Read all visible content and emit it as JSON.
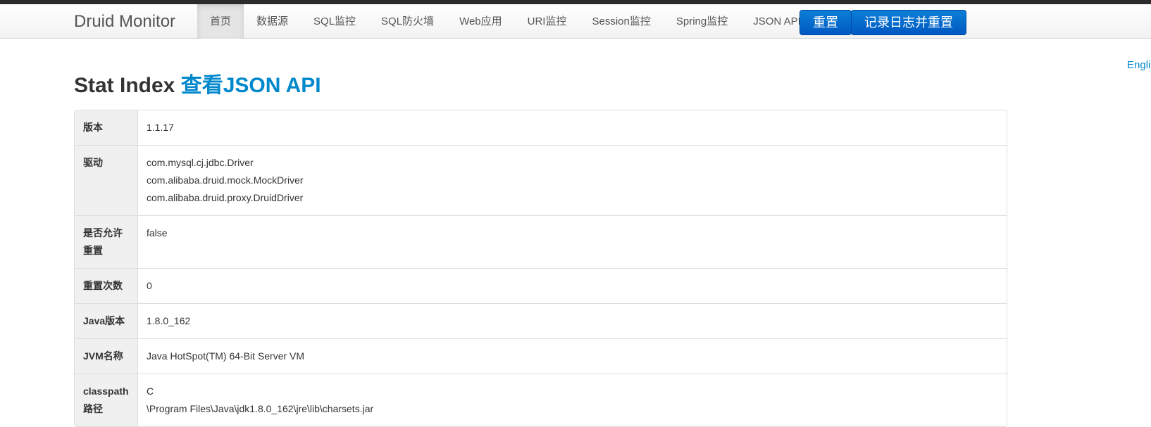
{
  "nav": {
    "brand": "Druid Monitor",
    "items": [
      {
        "label": "首页",
        "active": true
      },
      {
        "label": "数据源",
        "active": false
      },
      {
        "label": "SQL监控",
        "active": false
      },
      {
        "label": "SQL防火墙",
        "active": false
      },
      {
        "label": "Web应用",
        "active": false
      },
      {
        "label": "URI监控",
        "active": false
      },
      {
        "label": "Session监控",
        "active": false
      },
      {
        "label": "Spring监控",
        "active": false
      },
      {
        "label": "JSON API",
        "active": false
      }
    ],
    "reset_button": "重置",
    "log_reset_button": "记录日志并重置"
  },
  "lang_link": "Engli",
  "page": {
    "title": "Stat Index",
    "json_link": "查看JSON API"
  },
  "stats": [
    {
      "label": "版本",
      "values": [
        "1.1.17"
      ]
    },
    {
      "label": "驱动",
      "values": [
        "com.mysql.cj.jdbc.Driver",
        "com.alibaba.druid.mock.MockDriver",
        "com.alibaba.druid.proxy.DruidDriver"
      ]
    },
    {
      "label": "是否允许重置",
      "values": [
        "false"
      ]
    },
    {
      "label": "重置次数",
      "values": [
        "0"
      ]
    },
    {
      "label": "Java版本",
      "values": [
        "1.8.0_162"
      ]
    },
    {
      "label": "JVM名称",
      "values": [
        "Java HotSpot(TM) 64-Bit Server VM"
      ]
    },
    {
      "label": "classpath路径",
      "values": [
        "C",
        "\\Program Files\\Java\\jdk1.8.0_162\\jre\\lib\\charsets.jar"
      ]
    }
  ],
  "colors": {
    "link": "#0088cc",
    "primary_button": "#0064cd",
    "header_cell_bg": "#f0f0f0",
    "topline": "#2b2b2b"
  }
}
